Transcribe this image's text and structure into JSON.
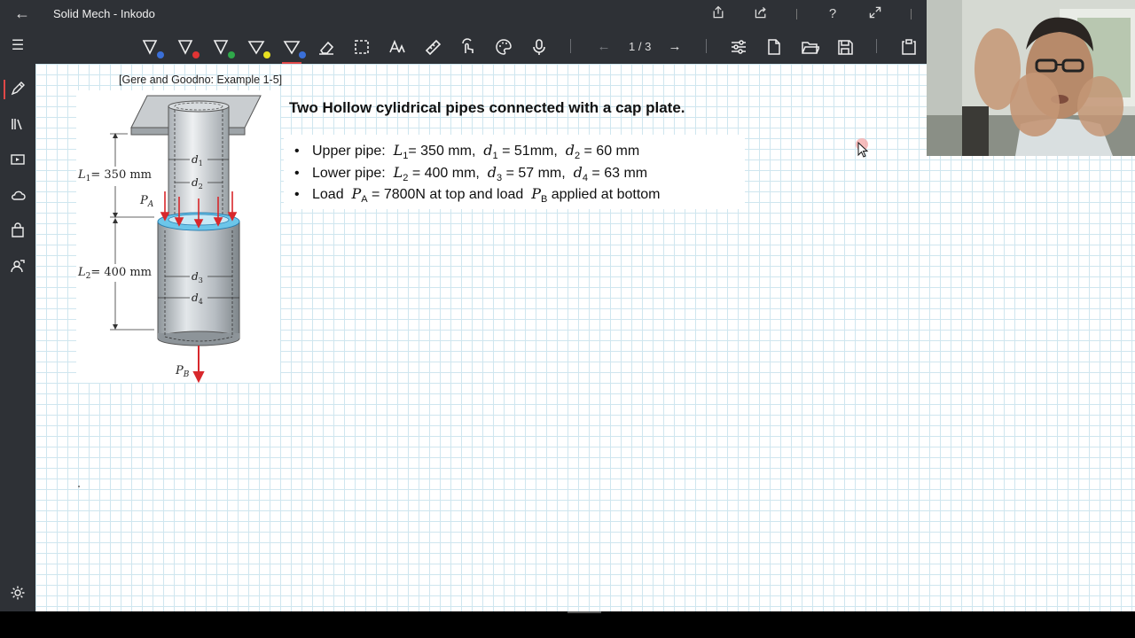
{
  "window": {
    "title": "Solid Mech - Inkodo"
  },
  "toolbar": {
    "page_indicator": "1 / 3",
    "pen_colors": [
      "#3a6fd8",
      "#e03434",
      "#2fa84a",
      "#e8e020",
      "#3a6fd8"
    ]
  },
  "icons": {
    "back": "arrow-left-icon",
    "share": "share-icon",
    "export": "export-icon",
    "help": "help-icon",
    "fullscreen": "expand-icon"
  },
  "document": {
    "citation": "[Gere and Goodno: Example 1-5]",
    "heading": "Two Hollow cylidrical pipes connected with a cap plate.",
    "bullets": [
      {
        "label": "Upper pipe:",
        "L_sym": "L",
        "L_sub": "1",
        "L_val": "= 350 mm,",
        "da_sym": "d",
        "da_sub": "1",
        "da_val": "= 51mm,",
        "db_sym": "d",
        "db_sub": "2",
        "db_val": "= 60 mm"
      },
      {
        "label": "Lower pipe:",
        "L_sym": "L",
        "L_sub": "2",
        "L_val": "= 400 mm,",
        "da_sym": "d",
        "da_sub": "3",
        "da_val": "= 57 mm,",
        "db_sym": "d",
        "db_sub": "4",
        "db_val": "= 63 mm"
      },
      {
        "label": "Load",
        "pa_sym": "P",
        "pa_sub": "A",
        "mid": "= 7800N at top and load",
        "pb_sym": "P",
        "pb_sub": "B",
        "end": "applied at bottom"
      }
    ]
  },
  "figure": {
    "L1_label": "L",
    "L1_sub": "1",
    "L1_val": "= 350 mm",
    "L2_label": "L",
    "L2_sub": "2",
    "L2_val": "= 400 mm",
    "PA_label": "P",
    "PA_sub": "A",
    "PB_label": "P",
    "PB_sub": "B",
    "d1": "d",
    "d1_sub": "1",
    "d2": "d",
    "d2_sub": "2",
    "d3": "d",
    "d3_sub": "3",
    "d4": "d",
    "d4_sub": "4"
  },
  "colors": {
    "chrome": "#2e3136",
    "grid": "#cfe6ef",
    "accent": "#e04848",
    "load_arrow": "#d8282c"
  }
}
